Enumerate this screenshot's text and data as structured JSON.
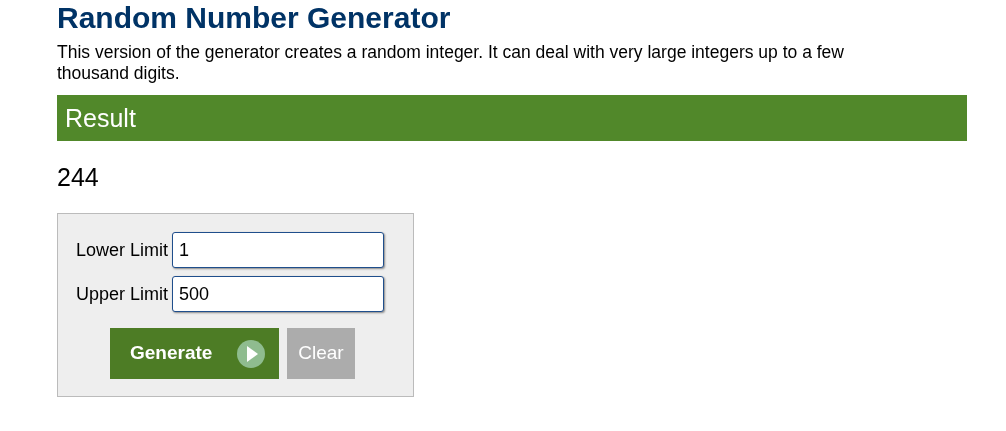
{
  "title": "Random Number Generator",
  "description": "This version of the generator creates a random integer. It can deal with very large integers up to a few thousand digits.",
  "result": {
    "heading": "Result",
    "value": "244"
  },
  "form": {
    "fields": [
      {
        "label": "Lower Limit",
        "value": "1"
      },
      {
        "label": "Upper Limit",
        "value": "500"
      }
    ],
    "buttons": [
      {
        "label": "Generate",
        "kind": "primary"
      },
      {
        "label": "Clear",
        "kind": "secondary"
      }
    ]
  }
}
